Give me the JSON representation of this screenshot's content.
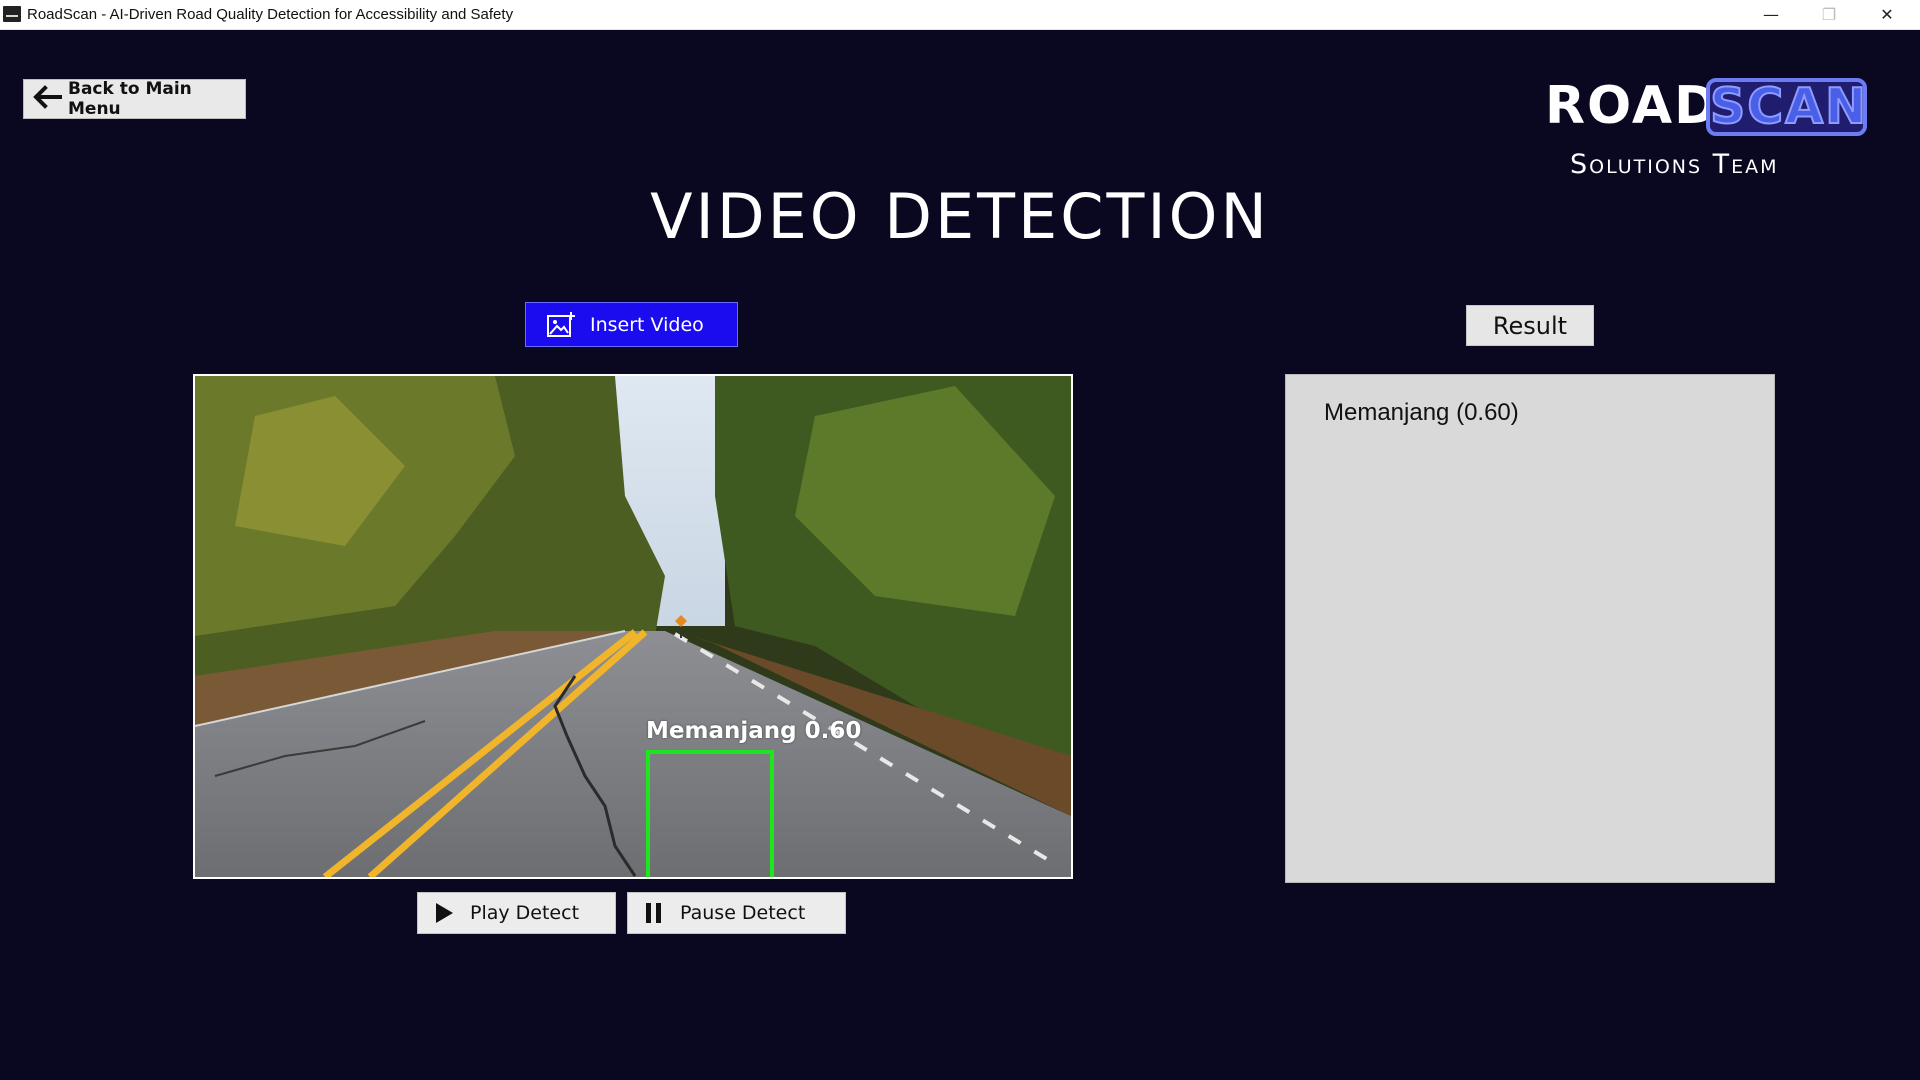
{
  "window": {
    "title": "RoadScan - AI-Driven Road Quality Detection for Accessibility and Safety",
    "minimize": "—",
    "maximize": "❐",
    "close": "✕"
  },
  "nav": {
    "back_label": "Back to Main Menu"
  },
  "logo": {
    "word1": "ROAD",
    "word2": "SCAN",
    "subtitle": "Solutions Team"
  },
  "page": {
    "title": "VIDEO DETECTION"
  },
  "input": {
    "insert_label": "Insert Video"
  },
  "video": {
    "detection_label": "Memanjang 0.60",
    "box_color": "#1fe51f"
  },
  "controls": {
    "play_label": "Play Detect",
    "pause_label": "Pause Detect"
  },
  "result": {
    "button_label": "Result",
    "items": [
      "Memanjang (0.60)"
    ]
  },
  "colors": {
    "background": "#0a0720",
    "accent_button": "#1b0cf0",
    "logo_scan": "#4a5fe8"
  },
  "icons": {
    "back": "arrow-left-icon",
    "insert": "image-add-icon",
    "play": "play-icon",
    "pause": "pause-icon"
  }
}
